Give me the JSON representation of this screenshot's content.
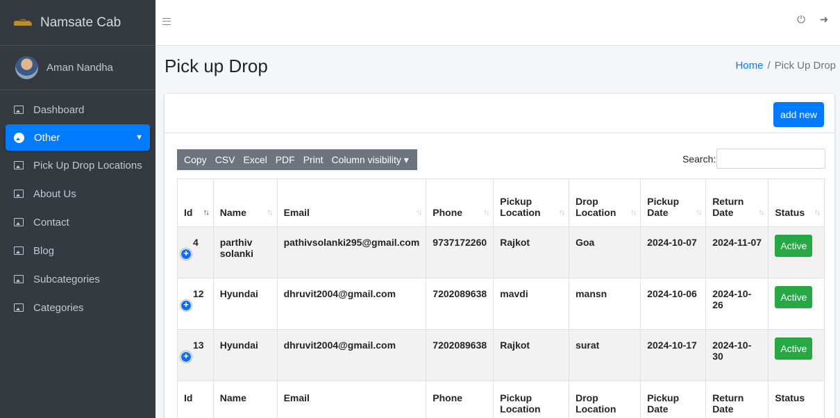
{
  "brand": {
    "name": "Namsate Cab"
  },
  "user": {
    "name": "Aman Nandha"
  },
  "sidebar": {
    "items": [
      {
        "label": "Dashboard",
        "icon": "image-icon"
      },
      {
        "label": "Other",
        "icon": "dashboard-icon",
        "active": true
      },
      {
        "label": "Pick Up Drop Locations",
        "icon": "image-icon"
      },
      {
        "label": "About Us",
        "icon": "image-icon"
      },
      {
        "label": "Contact",
        "icon": "image-icon"
      },
      {
        "label": "Blog",
        "icon": "image-icon"
      },
      {
        "label": "Subcategories",
        "icon": "image-icon"
      },
      {
        "label": "Categories",
        "icon": "image-icon"
      }
    ]
  },
  "page": {
    "title": "Pick up Drop",
    "breadcrumb": {
      "home": "Home",
      "separator": "/",
      "current": "Pick Up Drop"
    }
  },
  "card": {
    "add_label": "add new"
  },
  "export_buttons": [
    "Copy",
    "CSV",
    "Excel",
    "PDF",
    "Print",
    "Column visibility ▾"
  ],
  "search": {
    "label": "Search:",
    "value": "",
    "placeholder": ""
  },
  "table": {
    "headers": [
      "Id",
      "Name",
      "Email",
      "Phone",
      "Pickup Location",
      "Drop Location",
      "Pickup Date",
      "Return Date",
      "Status"
    ],
    "rows": [
      {
        "id": "4",
        "name": "parthiv solanki",
        "email": "pathivsolanki295@gmail.com",
        "phone": "9737172260",
        "pickup": "Rajkot",
        "drop": "Goa",
        "pickup_date": "2024-10-07",
        "return_date": "2024-11-07",
        "status": "Active"
      },
      {
        "id": "12",
        "name": "Hyundai",
        "email": "dhruvit2004@gmail.com",
        "phone": "7202089638",
        "pickup": "mavdi",
        "drop": "mansn",
        "pickup_date": "2024-10-06",
        "return_date": "2024-10-26",
        "status": "Active"
      },
      {
        "id": "13",
        "name": "Hyundai",
        "email": "dhruvit2004@gmail.com",
        "phone": "7202089638",
        "pickup": "Rajkot",
        "drop": "surat",
        "pickup_date": "2024-10-17",
        "return_date": "2024-10-30",
        "status": "Active"
      }
    ]
  },
  "colors": {
    "sidebar_bg": "#343a40",
    "accent": "#007bff",
    "status_active": "#28a745",
    "export_group": "#6c757d"
  }
}
